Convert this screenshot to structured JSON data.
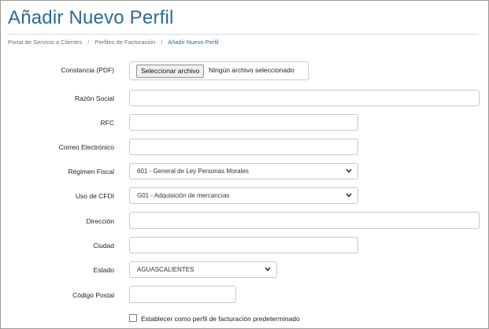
{
  "page": {
    "title": "Añadir Nuevo Perfil",
    "breadcrumb": [
      "Portal de Servicio a Clientes",
      "Perfiles de Facturación",
      "Añadir Nuevo Perfil"
    ],
    "breadcrumb_separator": "/"
  },
  "form": {
    "constancia": {
      "label": "Constancia (PDF)",
      "button_label": "Seleccionar archivo",
      "status": "Ningún archivo seleccionado"
    },
    "razon_social": {
      "label": "Razón Social",
      "value": ""
    },
    "rfc": {
      "label": "RFC",
      "value": ""
    },
    "correo": {
      "label": "Correo Electrónico",
      "value": ""
    },
    "regimen": {
      "label": "Régimen Fiscal",
      "selected": "601 - General de Ley Personas Morales"
    },
    "uso_cfdi": {
      "label": "Uso de CFDI",
      "selected": "G01 - Adquisición de mercancías"
    },
    "direccion": {
      "label": "Dirección",
      "value": ""
    },
    "ciudad": {
      "label": "Ciudad",
      "value": ""
    },
    "estado": {
      "label": "Estado",
      "selected": "AGUASCALIENTES"
    },
    "codigo_postal": {
      "label": "Código Postal",
      "value": ""
    },
    "default_checkbox": {
      "label": "Establecer como perfil de facturación predeterminado",
      "checked": false
    }
  },
  "colors": {
    "title": "#2b6a96",
    "breadcrumb_current": "#2b6a96",
    "border": "#c9c9c9"
  },
  "icons": {
    "select_chevron": "chevron-down-icon"
  }
}
